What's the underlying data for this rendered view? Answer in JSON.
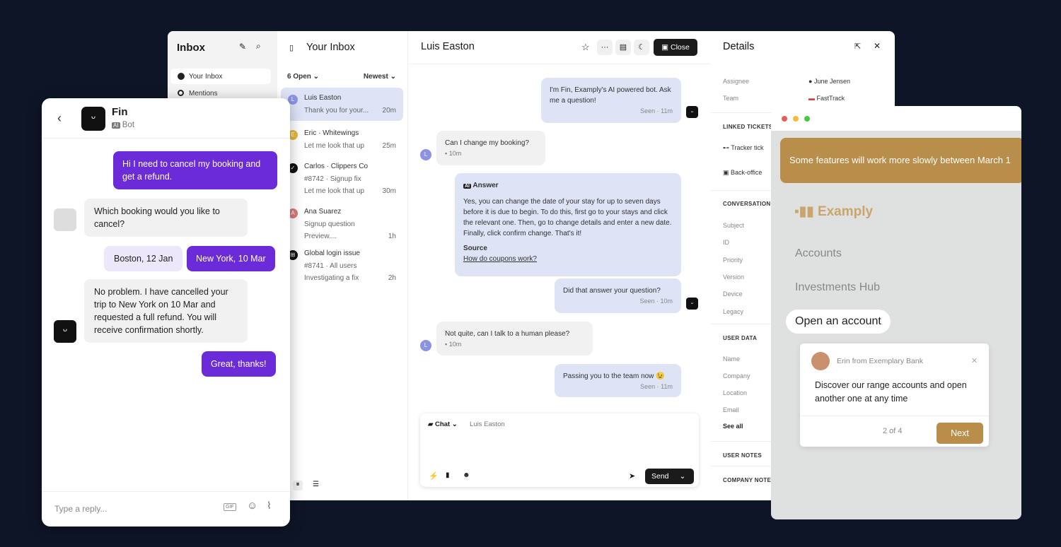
{
  "sidebar": {
    "title": "Inbox",
    "items": [
      {
        "label": "Your Inbox",
        "icon": "avatar-icon"
      },
      {
        "label": "Mentions",
        "icon": "at-icon"
      }
    ]
  },
  "list": {
    "title": "Your Inbox",
    "filter": "6 Open",
    "sort": "Newest",
    "conversations": [
      {
        "name": "Luis Easton",
        "initial": "L",
        "color": "#8b93e6",
        "lines": [
          "Thank you for your..."
        ],
        "time": "20m"
      },
      {
        "name": "Eric · Whitewings",
        "initial": "E",
        "color": "#e2b93b",
        "lines": [
          "Let me look that up"
        ],
        "time": "25m"
      },
      {
        "name": "Carlos · Clippers Co",
        "initial": "✓",
        "color": "#111",
        "lines": [
          "#8742 · Signup fix",
          "Let me look that up"
        ],
        "time": "30m"
      },
      {
        "name": "Ana Suarez",
        "initial": "A",
        "color": "#d77a7a",
        "lines": [
          "Signup question",
          "Preview...."
        ],
        "time": "1h"
      },
      {
        "name": "Global login issue",
        "initial": "⊞",
        "color": "#111",
        "lines": [
          "#8741 · All users",
          "Investigating a fix"
        ],
        "time": "2h"
      }
    ]
  },
  "chat": {
    "title": "Luis Easton",
    "close_label": "Close",
    "messages": {
      "m1": "I'm Fin, Examply's AI powered bot. Ask me a question!",
      "m1_meta": "Seen · 11m",
      "m2": "Can I change my booking?",
      "m2_meta": "10m",
      "answer_label": "Answer",
      "answer": "Yes, you can change the date of your stay for up to seven days before it is due to begin. To do this, first go to your stays and click the relevant one. Then, go to change details and enter a new date. Finally, click confirm change. That's it!",
      "source_label": "Source",
      "source_link": "How do coupons work?",
      "m3": "Did that answer your question?",
      "m3_meta": "Seen · 10m",
      "m4": "Not quite, can I talk to a human please?",
      "m4_meta": "10m",
      "m5": "Passing you to the team now 😉",
      "m5_meta": "Seen · 11m"
    },
    "composer": {
      "channel": "Chat",
      "recipient": "Luis Easton",
      "send_label": "Send"
    }
  },
  "details": {
    "title": "Details",
    "assignee_label": "Assignee",
    "assignee": "June Jensen",
    "team_label": "Team",
    "team": "FastTrack",
    "linked_tickets": "LINKED TICKETS",
    "tickets": [
      "Tracker tick",
      "Back-office"
    ],
    "conversation": "CONVERSATION",
    "conv_fields": [
      "Subject",
      "ID",
      "Priority",
      "Version",
      "Device",
      "Legacy"
    ],
    "user_data": "USER DATA",
    "user_fields": [
      "Name",
      "Company",
      "Location",
      "Email"
    ],
    "see_all": "See all",
    "user_notes": "USER NOTES",
    "company_notes": "COMPANY NOTE"
  },
  "fin": {
    "name": "Fin",
    "badge": "AI",
    "role": "Bot",
    "placeholder": "Type a reply...",
    "messages": {
      "u1": "Hi I need to cancel my booking and get a refund.",
      "b1": "Which booking would you like to cancel?",
      "opt1": "Boston, 12 Jan",
      "opt2": "New York, 10 Mar",
      "b2": "No problem. I have cancelled your trip to New York on 10 Mar and requested a full refund. You will receive confirmation shortly.",
      "u2": "Great, thanks!"
    },
    "accent": "#6c2bd9"
  },
  "examply": {
    "banner": "Some features will work more slowly between March 1",
    "brand": "Examply",
    "nav": [
      "Accounts",
      "Investments Hub",
      "Open an account"
    ],
    "tour": {
      "sender": "Erin from Exemplary Bank",
      "text": "Discover our range accounts and open another one at any time",
      "step": "2 of 4",
      "next": "Next"
    },
    "accent": "#b98d4a"
  }
}
